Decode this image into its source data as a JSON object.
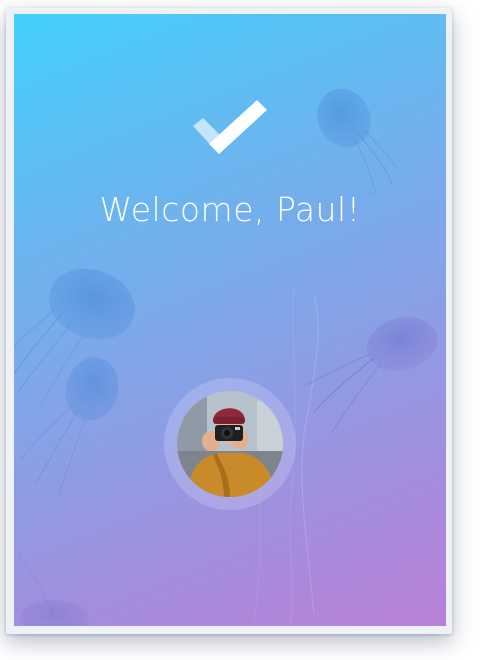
{
  "welcome": {
    "text": "Welcome, Paul!"
  },
  "icons": {
    "success": "checkmark-icon"
  },
  "user": {
    "avatar": "user-avatar-photo"
  },
  "colors": {
    "gradient_top": "#43d0fb",
    "gradient_bottom": "#b980d8",
    "text": "#ffffff"
  }
}
